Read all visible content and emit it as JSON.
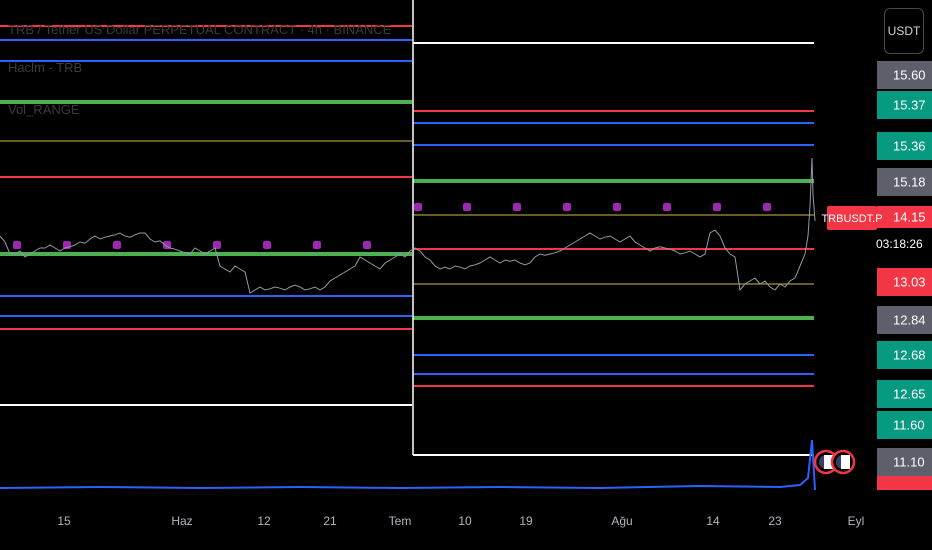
{
  "legend": {
    "line1": "TRB / Tether US Dollar PERPETUAL CONTRACT · 4h · BINANCE",
    "line2": "Haclm - TRB",
    "line3": "Vol_RANGE"
  },
  "currency_button": "USDT",
  "symbol_label": "TRBUSDT.P",
  "countdown": "03:18:26",
  "colors": {
    "red": "#f23645",
    "blue": "#2962ff",
    "green": "#4caf50",
    "yellow": "#d4b84a",
    "white": "#ffffff",
    "purple": "#9c27b0",
    "volume": "#2962ff",
    "badge_green": "#089981",
    "badge_red": "#f23645",
    "badge_gray": "#5d606b"
  },
  "chart_data": {
    "type": "line",
    "title": "TRB / Tether US Dollar PERPETUAL CONTRACT · 4h · BINANCE",
    "x_ticks": [
      "15",
      "Haz",
      "12",
      "21",
      "Tem",
      "10",
      "19",
      "Ağu",
      "14",
      "23",
      "Eyl"
    ],
    "price_badges": [
      {
        "value": "15.60",
        "kind": "gray"
      },
      {
        "value": "15.37",
        "kind": "green"
      },
      {
        "value": "15.36",
        "kind": "green"
      },
      {
        "value": "15.18",
        "kind": "gray"
      },
      {
        "value": "14.15",
        "kind": "red"
      },
      {
        "value": "13.03",
        "kind": "red"
      },
      {
        "value": "12.84",
        "kind": "gray"
      },
      {
        "value": "12.68",
        "kind": "green"
      },
      {
        "value": "12.65",
        "kind": "green"
      },
      {
        "value": "11.60",
        "kind": "green"
      },
      {
        "value": "11.10",
        "kind": "gray"
      }
    ],
    "last_price": 14.15,
    "price_path": [
      [
        0,
        13.9
      ],
      [
        5,
        13.8
      ],
      [
        10,
        13.6
      ],
      [
        15,
        13.6
      ],
      [
        20,
        13.65
      ],
      [
        25,
        13.55
      ],
      [
        30,
        13.6
      ],
      [
        35,
        13.65
      ],
      [
        40,
        13.7
      ],
      [
        45,
        13.7
      ],
      [
        50,
        13.75
      ],
      [
        55,
        13.7
      ],
      [
        60,
        13.65
      ],
      [
        65,
        13.7
      ],
      [
        70,
        13.72
      ],
      [
        75,
        13.75
      ],
      [
        80,
        13.8
      ],
      [
        85,
        13.78
      ],
      [
        90,
        13.85
      ],
      [
        95,
        13.9
      ],
      [
        100,
        13.85
      ],
      [
        105,
        13.88
      ],
      [
        110,
        13.9
      ],
      [
        115,
        13.92
      ],
      [
        120,
        13.95
      ],
      [
        125,
        13.9
      ],
      [
        130,
        13.88
      ],
      [
        135,
        13.92
      ],
      [
        140,
        13.95
      ],
      [
        145,
        13.95
      ],
      [
        150,
        13.85
      ],
      [
        155,
        13.8
      ],
      [
        160,
        13.82
      ],
      [
        165,
        13.75
      ],
      [
        170,
        13.7
      ],
      [
        175,
        13.68
      ],
      [
        180,
        13.65
      ],
      [
        185,
        13.62
      ],
      [
        190,
        13.6
      ],
      [
        195,
        13.7
      ],
      [
        200,
        13.65
      ],
      [
        205,
        13.6
      ],
      [
        210,
        13.65
      ],
      [
        215,
        13.7
      ],
      [
        220,
        13.4
      ],
      [
        225,
        13.35
      ],
      [
        230,
        13.3
      ],
      [
        235,
        13.4
      ],
      [
        240,
        13.35
      ],
      [
        245,
        13.3
      ],
      [
        250,
        12.95
      ],
      [
        255,
        13.0
      ],
      [
        260,
        13.05
      ],
      [
        265,
        13.0
      ],
      [
        270,
        13.02
      ],
      [
        275,
        13.05
      ],
      [
        280,
        13.03
      ],
      [
        285,
        13.0
      ],
      [
        290,
        13.05
      ],
      [
        295,
        13.08
      ],
      [
        300,
        13.05
      ],
      [
        305,
        13.0
      ],
      [
        310,
        13.02
      ],
      [
        315,
        13.05
      ],
      [
        320,
        13.0
      ],
      [
        325,
        13.05
      ],
      [
        330,
        13.15
      ],
      [
        335,
        13.2
      ],
      [
        340,
        13.25
      ],
      [
        345,
        13.3
      ],
      [
        350,
        13.35
      ],
      [
        355,
        13.4
      ],
      [
        360,
        13.55
      ],
      [
        365,
        13.5
      ],
      [
        370,
        13.45
      ],
      [
        375,
        13.4
      ],
      [
        380,
        13.35
      ],
      [
        385,
        13.45
      ],
      [
        390,
        13.5
      ],
      [
        395,
        13.55
      ],
      [
        400,
        13.6
      ],
      [
        405,
        13.55
      ],
      [
        410,
        13.65
      ],
      [
        415,
        13.7
      ],
      [
        420,
        13.65
      ],
      [
        425,
        13.55
      ],
      [
        430,
        13.5
      ],
      [
        435,
        13.4
      ],
      [
        440,
        13.35
      ],
      [
        445,
        13.38
      ],
      [
        450,
        13.35
      ],
      [
        455,
        13.4
      ],
      [
        460,
        13.38
      ],
      [
        465,
        13.35
      ],
      [
        470,
        13.4
      ],
      [
        475,
        13.42
      ],
      [
        480,
        13.45
      ],
      [
        485,
        13.5
      ],
      [
        490,
        13.55
      ],
      [
        495,
        13.5
      ],
      [
        500,
        13.45
      ],
      [
        505,
        13.5
      ],
      [
        510,
        13.48
      ],
      [
        515,
        13.5
      ],
      [
        520,
        13.45
      ],
      [
        525,
        13.42
      ],
      [
        530,
        13.45
      ],
      [
        535,
        13.55
      ],
      [
        540,
        13.6
      ],
      [
        545,
        13.58
      ],
      [
        550,
        13.6
      ],
      [
        555,
        13.62
      ],
      [
        560,
        13.65
      ],
      [
        565,
        13.7
      ],
      [
        570,
        13.75
      ],
      [
        575,
        13.8
      ],
      [
        580,
        13.85
      ],
      [
        585,
        13.9
      ],
      [
        590,
        13.95
      ],
      [
        595,
        13.9
      ],
      [
        600,
        13.85
      ],
      [
        605,
        13.88
      ],
      [
        610,
        13.9
      ],
      [
        615,
        13.85
      ],
      [
        620,
        13.8
      ],
      [
        625,
        13.85
      ],
      [
        630,
        13.9
      ],
      [
        635,
        13.8
      ],
      [
        640,
        13.75
      ],
      [
        645,
        13.7
      ],
      [
        650,
        13.65
      ],
      [
        655,
        13.7
      ],
      [
        660,
        13.72
      ],
      [
        665,
        13.7
      ],
      [
        670,
        13.68
      ],
      [
        675,
        13.65
      ],
      [
        680,
        13.6
      ],
      [
        685,
        13.62
      ],
      [
        690,
        13.65
      ],
      [
        695,
        13.6
      ],
      [
        700,
        13.55
      ],
      [
        705,
        13.6
      ],
      [
        710,
        13.95
      ],
      [
        715,
        14.0
      ],
      [
        720,
        13.9
      ],
      [
        725,
        13.7
      ],
      [
        730,
        13.6
      ],
      [
        735,
        13.55
      ],
      [
        740,
        13.0
      ],
      [
        745,
        13.1
      ],
      [
        750,
        13.15
      ],
      [
        755,
        13.2
      ],
      [
        760,
        13.1
      ],
      [
        765,
        13.15
      ],
      [
        770,
        13.05
      ],
      [
        775,
        13.0
      ],
      [
        780,
        13.1
      ],
      [
        785,
        13.05
      ],
      [
        790,
        13.15
      ],
      [
        795,
        13.2
      ],
      [
        800,
        13.4
      ],
      [
        805,
        13.6
      ],
      [
        808,
        13.9
      ],
      [
        810,
        14.4
      ],
      [
        812,
        15.2
      ],
      [
        813,
        14.6
      ],
      [
        815,
        14.15
      ]
    ]
  }
}
